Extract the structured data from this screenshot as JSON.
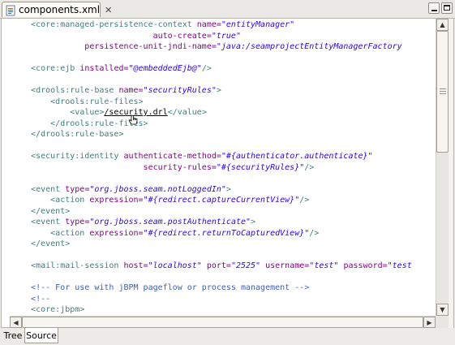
{
  "editor_tab": {
    "title": "components.xml",
    "icon": "xml-file-icon",
    "close_label": "✕"
  },
  "window_controls": [
    "minimize-button",
    "maximize-button"
  ],
  "code_lines": [
    [
      {
        "k": "t",
        "s": "    <core:managed-persistence-context "
      },
      {
        "k": "a",
        "s": "name="
      },
      {
        "k": "v",
        "s": "\"entityManager\""
      }
    ],
    [
      {
        "k": "a",
        "s": "                             auto-create="
      },
      {
        "k": "v",
        "s": "\"true\""
      }
    ],
    [
      {
        "k": "a",
        "s": "               persistence-unit-jndi-name="
      },
      {
        "k": "v",
        "s": "\"java:/seamprojectEntityManagerFactory"
      }
    ],
    [],
    [
      {
        "k": "t",
        "s": "    <core:ejb "
      },
      {
        "k": "a",
        "s": "installed="
      },
      {
        "k": "v",
        "s": "\"@embeddedEjb@\""
      },
      {
        "k": "t",
        "s": "/>"
      }
    ],
    [],
    [
      {
        "k": "t",
        "s": "    <drools:rule-base "
      },
      {
        "k": "a",
        "s": "name="
      },
      {
        "k": "v",
        "s": "\"securityRules\""
      },
      {
        "k": "t",
        "s": ">"
      }
    ],
    [
      {
        "k": "t",
        "s": "        <drools:rule-files>"
      }
    ],
    [
      {
        "k": "t",
        "s": "            <value>"
      },
      {
        "k": "link",
        "s": "/security.drl"
      },
      {
        "k": "t",
        "s": "</value>"
      }
    ],
    [
      {
        "k": "t",
        "s": "        </drools:rule-files>"
      }
    ],
    [
      {
        "k": "t",
        "s": "    </drools:rule-base>"
      }
    ],
    [],
    [
      {
        "k": "t",
        "s": "    <security:identity "
      },
      {
        "k": "a",
        "s": "authenticate-method="
      },
      {
        "k": "v",
        "s": "\"#{authenticator.authenticate}\""
      }
    ],
    [
      {
        "k": "a",
        "s": "                           security-rules="
      },
      {
        "k": "v",
        "s": "\"#{securityRules}\""
      },
      {
        "k": "t",
        "s": "/>"
      }
    ],
    [],
    [
      {
        "k": "t",
        "s": "    <event "
      },
      {
        "k": "a",
        "s": "type="
      },
      {
        "k": "v",
        "s": "\"org.jboss.seam.notLoggedIn\""
      },
      {
        "k": "t",
        "s": ">"
      }
    ],
    [
      {
        "k": "t",
        "s": "        <action "
      },
      {
        "k": "a",
        "s": "expression="
      },
      {
        "k": "v",
        "s": "\"#{redirect.captureCurrentView}\""
      },
      {
        "k": "t",
        "s": "/>"
      }
    ],
    [
      {
        "k": "t",
        "s": "    </event>"
      }
    ],
    [
      {
        "k": "t",
        "s": "    <event "
      },
      {
        "k": "a",
        "s": "type="
      },
      {
        "k": "v",
        "s": "\"org.jboss.seam.postAuthenticate\""
      },
      {
        "k": "t",
        "s": ">"
      }
    ],
    [
      {
        "k": "t",
        "s": "        <action "
      },
      {
        "k": "a",
        "s": "expression="
      },
      {
        "k": "v",
        "s": "\"#{redirect.returnToCapturedView}\""
      },
      {
        "k": "t",
        "s": "/>"
      }
    ],
    [
      {
        "k": "t",
        "s": "    </event>"
      }
    ],
    [],
    [
      {
        "k": "t",
        "s": "    <mail:mail-session "
      },
      {
        "k": "a",
        "s": "host="
      },
      {
        "k": "v",
        "s": "\"localhost\""
      },
      {
        "k": "a",
        "s": " port="
      },
      {
        "k": "v",
        "s": "\"2525\""
      },
      {
        "k": "a",
        "s": " username="
      },
      {
        "k": "v",
        "s": "\"test\""
      },
      {
        "k": "a",
        "s": " password="
      },
      {
        "k": "v",
        "s": "\"test"
      }
    ],
    [],
    [
      {
        "k": "c",
        "s": "    <!-- For use with jBPM pageflow or process management -->"
      }
    ],
    [
      {
        "k": "c",
        "s": "    <!--"
      }
    ],
    [
      {
        "k": "t",
        "s": "    <core:jbpm>"
      }
    ]
  ],
  "bottom_tabs": {
    "tree": "Tree",
    "source": "Source"
  },
  "colors": {
    "tag": "#3f7f7f",
    "attribute": "#7f007f",
    "value": "#2a00ff",
    "comment": "#3f5fbf"
  }
}
